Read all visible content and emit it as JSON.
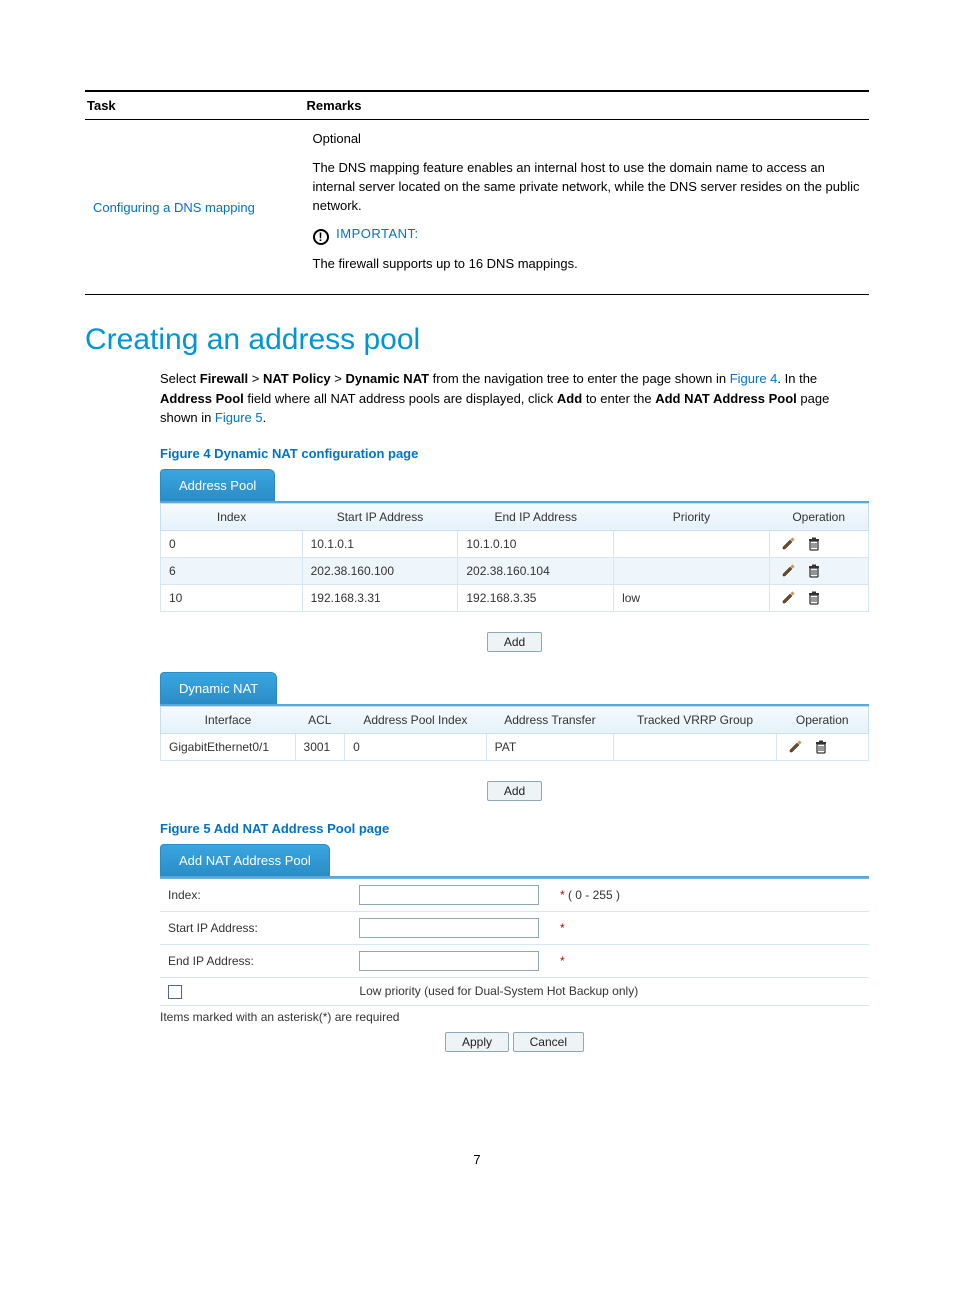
{
  "task_table": {
    "headers": {
      "task": "Task",
      "remarks": "Remarks"
    },
    "row": {
      "task_link": "Configuring a DNS mapping",
      "optional": "Optional",
      "desc": "The DNS mapping feature enables an internal host to use the domain name to access an internal server located on the same private network, while the DNS server resides on the public network.",
      "important_label": "IMPORTANT:",
      "important_text": "The firewall supports up to 16 DNS mappings."
    }
  },
  "section_title": "Creating an address pool",
  "para": {
    "p1a": "Select ",
    "firewall": "Firewall",
    "gt1": " > ",
    "nat_policy": "NAT Policy",
    "gt2": " > ",
    "dynamic_nat": "Dynamic NAT",
    "p1b": " from the navigation tree to enter the page shown in ",
    "fig4_link": "Figure 4",
    "p1c": ". In the ",
    "address_pool": "Address Pool",
    "p1d": " field where all NAT address pools are displayed, click ",
    "add": "Add",
    "p1e": " to enter the ",
    "add_nat": "Add NAT Address Pool",
    "p1f": " page shown in ",
    "fig5_link": "Figure 5",
    "p1g": "."
  },
  "figure4_caption": "Figure 4 Dynamic NAT configuration page",
  "figure5_caption": "Figure 5 Add NAT Address Pool page",
  "address_pool_tab": "Address Pool",
  "ap_headers": {
    "index": "Index",
    "start": "Start IP Address",
    "end": "End IP Address",
    "priority": "Priority",
    "op": "Operation"
  },
  "ap_rows": [
    {
      "index": "0",
      "start": "10.1.0.1",
      "end": "10.1.0.10",
      "priority": ""
    },
    {
      "index": "6",
      "start": "202.38.160.100",
      "end": "202.38.160.104",
      "priority": ""
    },
    {
      "index": "10",
      "start": "192.168.3.31",
      "end": "192.168.3.35",
      "priority": "low"
    }
  ],
  "add_label": "Add",
  "dynamic_nat_tab": "Dynamic NAT",
  "dn_headers": {
    "iface": "Interface",
    "acl": "ACL",
    "api": "Address Pool Index",
    "at": "Address Transfer",
    "tvg": "Tracked VRRP Group",
    "op": "Operation"
  },
  "dn_rows": [
    {
      "iface": "GigabitEthernet0/1",
      "acl": "3001",
      "api": "0",
      "at": "PAT",
      "tvg": ""
    }
  ],
  "add_form": {
    "tab": "Add NAT Address Pool",
    "index_label": "Index:",
    "index_hint": "* ( 0 - 255 )",
    "start_label": "Start IP Address:",
    "end_label": "End IP Address:",
    "asterisk": "*",
    "low_priority": "Low priority (used for Dual-System Hot Backup only)",
    "required_note": "Items marked with an asterisk(*) are required",
    "apply": "Apply",
    "cancel": "Cancel"
  },
  "page_number": "7"
}
